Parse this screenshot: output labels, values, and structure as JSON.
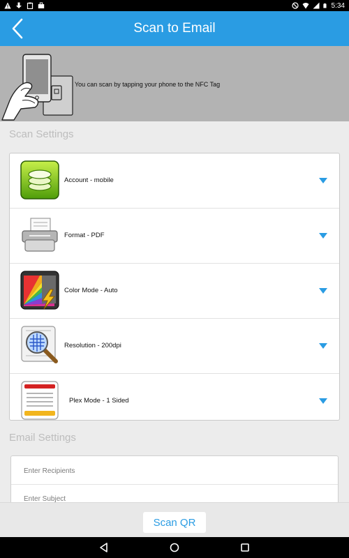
{
  "status_bar": {
    "time": "5:34"
  },
  "header": {
    "title": "Scan to Email"
  },
  "nfc_banner": {
    "text": "You can scan by tapping your phone to the NFC Tag"
  },
  "scan_settings": {
    "header": "Scan Settings",
    "items": [
      {
        "label": "Account - mobile",
        "icon": "account-database-icon"
      },
      {
        "label": "Format - PDF",
        "icon": "format-scanner-icon"
      },
      {
        "label": "Color Mode - Auto",
        "icon": "color-mode-icon"
      },
      {
        "label": "Resolution - 200dpi",
        "icon": "resolution-magnifier-icon"
      },
      {
        "label": "Plex Mode - 1 Sided",
        "icon": "plex-mode-icon"
      }
    ]
  },
  "email_settings": {
    "header": "Email Settings",
    "recipients_placeholder": "Enter Recipients",
    "subject_placeholder": "Enter Subject"
  },
  "bottom_bar": {
    "scan_qr_label": "Scan QR"
  },
  "colors": {
    "accent": "#2a9ce3",
    "banner": "#b3b3b3",
    "background": "#ececec"
  }
}
